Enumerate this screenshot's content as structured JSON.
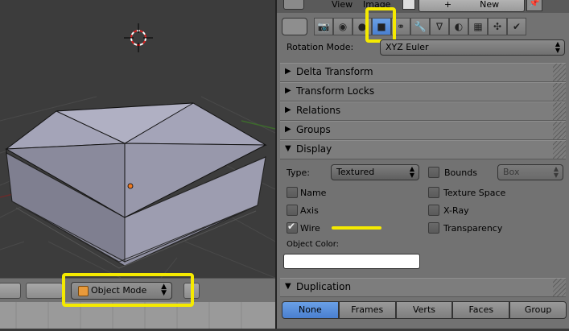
{
  "viewport": {
    "mode_label": "Object Mode"
  },
  "props_header": {
    "view_menu": "View",
    "image_menu": "Image",
    "new_button": "New"
  },
  "tabs": [
    {
      "icon": "render-icon"
    },
    {
      "icon": "scene-icon"
    },
    {
      "icon": "world-icon"
    },
    {
      "icon": "object-icon",
      "active": true
    },
    {
      "icon": "constraints-icon"
    },
    {
      "icon": "modifiers-icon"
    },
    {
      "icon": "data-icon"
    },
    {
      "icon": "material-icon"
    },
    {
      "icon": "texture-icon"
    },
    {
      "icon": "particles-icon"
    },
    {
      "icon": "physics-icon"
    }
  ],
  "rotation": {
    "label": "Rotation Mode:",
    "value": "XYZ Euler"
  },
  "sections": {
    "delta": "Delta Transform",
    "locks": "Transform Locks",
    "relations": "Relations",
    "groups": "Groups",
    "display": "Display",
    "duplication": "Duplication"
  },
  "display": {
    "type_label": "Type:",
    "type_value": "Textured",
    "bounds_label": "Bounds",
    "bounds_value": "Box",
    "name_label": "Name",
    "axis_label": "Axis",
    "wire_label": "Wire",
    "texture_space_label": "Texture Space",
    "xray_label": "X-Ray",
    "transparency_label": "Transparency",
    "object_color_label": "Object Color:",
    "wire_checked": true
  },
  "duplication": {
    "options": [
      "None",
      "Frames",
      "Verts",
      "Faces",
      "Group"
    ],
    "selected": "None"
  },
  "colors": {
    "highlight": "#f5ea00",
    "active_blue": "#4a7fcf",
    "panel_bg": "#727272"
  }
}
